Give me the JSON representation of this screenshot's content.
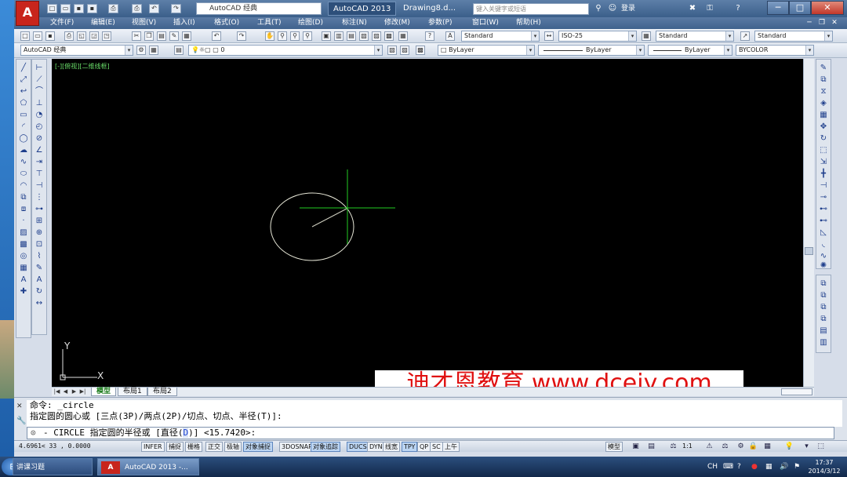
{
  "title_bar": {
    "app_logo": "A",
    "workspace": "AutoCAD 经典",
    "tabs": [
      "AutoCAD 2013",
      "Drawing8.d..."
    ],
    "search_placeholder": "键入关键字或短语",
    "login": "登录"
  },
  "menu": {
    "items": [
      "文件(F)",
      "编辑(E)",
      "视图(V)",
      "插入(I)",
      "格式(O)",
      "工具(T)",
      "绘图(D)",
      "标注(N)",
      "修改(M)",
      "参数(P)",
      "窗口(W)",
      "帮助(H)"
    ]
  },
  "toolbar": {
    "text_style": "Standard",
    "dim_style": "ISO-25",
    "table_style": "Standard",
    "multileader_style": "Standard",
    "workspace_combo": "AutoCAD 经典",
    "layer": "0",
    "color": "ByLayer",
    "linetype": "ByLayer",
    "lineweight": "ByLayer",
    "plot_style": "BYCOLOR"
  },
  "viewport": {
    "label": "[-][俯视][二维线框]",
    "ucs_x": "X",
    "ucs_y": "Y"
  },
  "watermark": "迪才恩教育 www.dcejy.com",
  "layout_tabs": [
    "模型",
    "布局1",
    "布局2"
  ],
  "command": {
    "line1": "命令: _circle",
    "line2": "指定圆的圆心或 [三点(3P)/两点(2P)/切点、切点、半径(T)]:",
    "prompt_prefix": "- CIRCLE 指定圆的半径或 [直径(",
    "prompt_option": "D",
    "prompt_suffix": ")] <15.7420>:"
  },
  "status": {
    "coords": "4.6961<   33      , 0.0000",
    "toggles": [
      {
        "label": "INFER",
        "on": false
      },
      {
        "label": "捕捉",
        "on": false
      },
      {
        "label": "栅格",
        "on": false
      },
      {
        "label": "正交",
        "on": false
      },
      {
        "label": "极轴",
        "on": false
      },
      {
        "label": "对象捕捉",
        "on": true
      },
      {
        "label": "3DOSNAP",
        "on": false
      },
      {
        "label": "对象追踪",
        "on": true
      },
      {
        "label": "DUCS",
        "on": true
      },
      {
        "label": "DYN",
        "on": false
      },
      {
        "label": "线宽",
        "on": false
      },
      {
        "label": "TPY",
        "on": true
      },
      {
        "label": "QP",
        "on": false
      },
      {
        "label": "SC",
        "on": false
      },
      {
        "label": "上午",
        "on": false
      }
    ],
    "model": "模型",
    "scale": "1:1"
  },
  "taskbar": {
    "tasks": [
      "讲课习题",
      "AutoCAD 2013 -..."
    ],
    "lang": "CH",
    "time": "17:37",
    "date": "2014/3/12"
  },
  "colors": {
    "canvas": "#000000",
    "circle": "#e8e8d8",
    "crosshair": "#22cc22",
    "watermark": "#e01010"
  }
}
